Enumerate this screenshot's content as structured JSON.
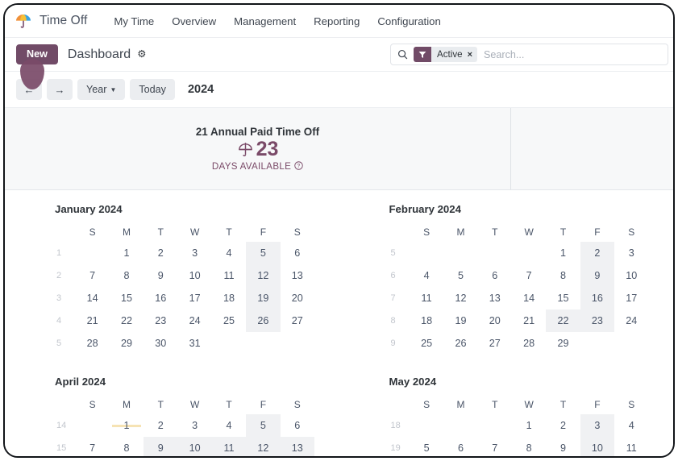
{
  "app": {
    "brand": "Time Off",
    "logo_icon": "parasol-icon",
    "nav_items": [
      "My Time",
      "Overview",
      "Management",
      "Reporting",
      "Configuration"
    ]
  },
  "control_panel": {
    "new_label": "New",
    "breadcrumb_title": "Dashboard",
    "gear_icon": "gear-icon",
    "search": {
      "search_icon": "search-icon",
      "facet_icon": "filter-funnel-icon",
      "facet_label": "Active",
      "facet_remove": "×",
      "placeholder": "Search...",
      "value": ""
    }
  },
  "calendar_toolbar": {
    "prev_label": "←",
    "next_label": "→",
    "scale_label": "Year",
    "today_label": "Today",
    "period_label": "2024",
    "pointer_icon": "click-pointer-indicator"
  },
  "hero": {
    "title": "21 Annual Paid Time Off",
    "icon": "parasol-icon",
    "count": "23",
    "subtitle": "DAYS AVAILABLE",
    "help_icon": "question-mark-icon"
  },
  "colors": {
    "accent": "#714b67",
    "hero_text": "#7a4a68",
    "highlight": "#f0f1f3",
    "event_band": "#f6e3b4"
  },
  "calendars": [
    {
      "title": "January 2024",
      "day_headers": [
        "S",
        "M",
        "T",
        "W",
        "T",
        "F",
        "S"
      ],
      "weeks": [
        {
          "wk": "1",
          "days": [
            "",
            "1",
            "2",
            "3",
            "4",
            "5",
            "6"
          ],
          "hl": [
            5
          ],
          "ev": []
        },
        {
          "wk": "2",
          "days": [
            "7",
            "8",
            "9",
            "10",
            "11",
            "12",
            "13"
          ],
          "hl": [
            5
          ],
          "ev": []
        },
        {
          "wk": "3",
          "days": [
            "14",
            "15",
            "16",
            "17",
            "18",
            "19",
            "20"
          ],
          "hl": [
            5
          ],
          "ev": []
        },
        {
          "wk": "4",
          "days": [
            "21",
            "22",
            "23",
            "24",
            "25",
            "26",
            "27"
          ],
          "hl": [
            5
          ],
          "ev": []
        },
        {
          "wk": "5",
          "days": [
            "28",
            "29",
            "30",
            "31",
            "",
            "",
            ""
          ],
          "hl": [],
          "ev": []
        }
      ]
    },
    {
      "title": "February 2024",
      "day_headers": [
        "S",
        "M",
        "T",
        "W",
        "T",
        "F",
        "S"
      ],
      "weeks": [
        {
          "wk": "5",
          "days": [
            "",
            "",
            "",
            "",
            "1",
            "2",
            "3"
          ],
          "hl": [
            5
          ],
          "ev": []
        },
        {
          "wk": "6",
          "days": [
            "4",
            "5",
            "6",
            "7",
            "8",
            "9",
            "10"
          ],
          "hl": [
            5
          ],
          "ev": []
        },
        {
          "wk": "7",
          "days": [
            "11",
            "12",
            "13",
            "14",
            "15",
            "16",
            "17"
          ],
          "hl": [
            5
          ],
          "ev": []
        },
        {
          "wk": "8",
          "days": [
            "18",
            "19",
            "20",
            "21",
            "22",
            "23",
            "24"
          ],
          "hl": [
            4,
            5
          ],
          "ev": []
        },
        {
          "wk": "9",
          "days": [
            "25",
            "26",
            "27",
            "28",
            "29",
            "",
            ""
          ],
          "hl": [],
          "ev": []
        }
      ]
    },
    {
      "title": "April 2024",
      "day_headers": [
        "S",
        "M",
        "T",
        "W",
        "T",
        "F",
        "S"
      ],
      "weeks": [
        {
          "wk": "14",
          "days": [
            "",
            "1",
            "2",
            "3",
            "4",
            "5",
            "6"
          ],
          "hl": [
            5
          ],
          "ev": [
            1
          ]
        },
        {
          "wk": "15",
          "days": [
            "7",
            "8",
            "9",
            "10",
            "11",
            "12",
            "13"
          ],
          "hl": [
            2,
            3,
            4,
            5,
            6
          ],
          "ev": []
        }
      ]
    },
    {
      "title": "May 2024",
      "day_headers": [
        "S",
        "M",
        "T",
        "W",
        "T",
        "F",
        "S"
      ],
      "weeks": [
        {
          "wk": "18",
          "days": [
            "",
            "",
            "",
            "1",
            "2",
            "3",
            "4"
          ],
          "hl": [
            5
          ],
          "ev": []
        },
        {
          "wk": "19",
          "days": [
            "5",
            "6",
            "7",
            "8",
            "9",
            "10",
            "11"
          ],
          "hl": [
            5
          ],
          "ev": []
        }
      ]
    }
  ]
}
